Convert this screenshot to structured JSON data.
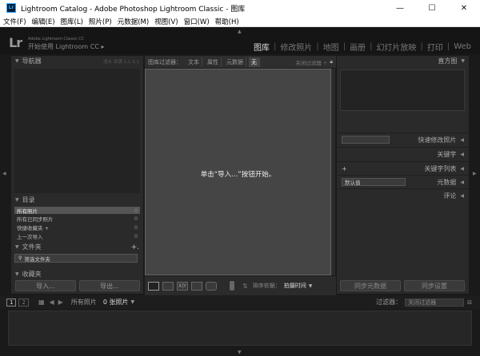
{
  "window": {
    "title": "Lightroom Catalog - Adobe Photoshop Lightroom Classic - 图库",
    "app_icon": "Lr",
    "controls": [
      "—",
      "☐",
      "✕"
    ]
  },
  "menu": [
    "文件(F)",
    "编辑(E)",
    "图库(L)",
    "照片(P)",
    "元数据(M)",
    "视图(V)",
    "窗口(W)",
    "帮助(H)"
  ],
  "identity": {
    "logo": "Lr",
    "small": "Adobe Lightroom Classic CC",
    "main": "开始使用 Lightroom CC  ▸"
  },
  "modules": [
    "图库",
    "修改照片",
    "地图",
    "画册",
    "幻灯片放映",
    "打印",
    "Web"
  ],
  "active_module": "图库",
  "left": {
    "navigator_title": "导航器",
    "navigator_zoom": "适合  填满  1:1  3:1",
    "catalog_title": "目录",
    "catalog_items": [
      {
        "label": "所有照片",
        "count": "0"
      },
      {
        "label": "所有已同步照片",
        "count": "0"
      },
      {
        "label": "快捷收藏夹 +",
        "count": "0"
      },
      {
        "label": "上一次导入",
        "count": "0"
      }
    ],
    "folders_title": "文件夹",
    "folder_filter": "筛选文件夹",
    "collections_title": "收藏夹",
    "import_button": "导入...",
    "export_button": "导出..."
  },
  "center": {
    "filter_label": "图库过滤器：",
    "filters": [
      "文本",
      "属性",
      "元数据",
      "无"
    ],
    "filter_active": "无",
    "filter_preset": "关闭过滤器 ÷",
    "empty_hint": "单击“导入...”按钮开始。",
    "sort_label": "排序依据：",
    "sort_value": "拍摄时间"
  },
  "right": {
    "histogram_title": "直方图",
    "quick_develop": "快速修改照片",
    "keywording": "关键字",
    "keyword_list": "关键字列表",
    "metadata": "元数据",
    "metadata_preset": "默认值",
    "comments": "评论",
    "sync_metadata_button": "同步元数据",
    "sync_settings_button": "同步设置"
  },
  "filmstrip": {
    "page1": "1",
    "page2": "2",
    "source": "所有照片",
    "count": "0 张照片",
    "filter_label": "过滤器：",
    "filter_value": "关闭过滤器"
  }
}
